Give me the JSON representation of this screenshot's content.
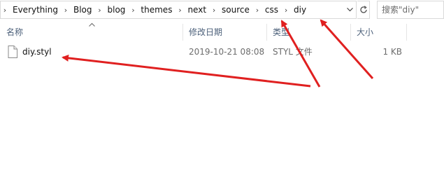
{
  "address_bar": {
    "crumbs": [
      "Everything",
      "Blog",
      "blog",
      "themes",
      "next",
      "source",
      "css",
      "diy"
    ]
  },
  "search": {
    "placeholder": "搜索\"diy\""
  },
  "columns": {
    "name": "名称",
    "date": "修改日期",
    "type": "类型",
    "size": "大小"
  },
  "files": [
    {
      "name": "diy.styl",
      "date": "2019-10-21 08:08",
      "type": "STYL 文件",
      "size": "1 KB"
    }
  ],
  "icons": {
    "crumb_separator": "chevron-right-icon",
    "address_dropdown": "chevron-down-icon",
    "refresh": "refresh-icon",
    "file": "file-icon",
    "sort": "sort-up-icon"
  },
  "colors": {
    "annotation_arrow": "#e02020",
    "header_text": "#4c607a"
  }
}
